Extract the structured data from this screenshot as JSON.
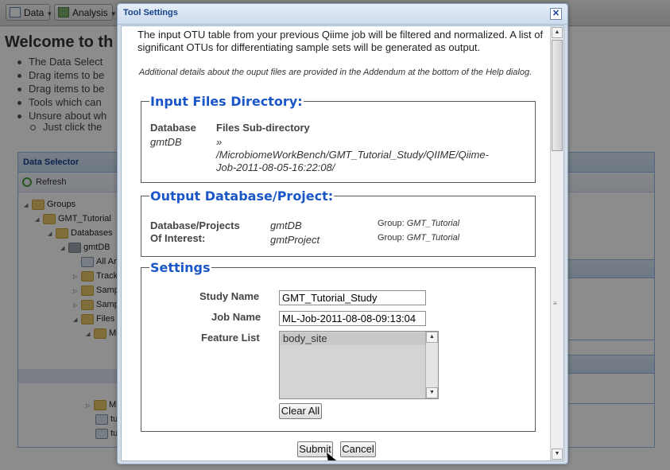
{
  "toolbar": {
    "data_label": "Data",
    "analysis_label": "Analysis"
  },
  "welcome": {
    "title": "Welcome to th",
    "bullets": [
      "The Data Select",
      "Drag items to be",
      "Drag items to be",
      "Tools which can",
      "Unsure about wh"
    ],
    "sub_bullet": "Just click the"
  },
  "data_selector": {
    "title": "Data Selector",
    "refresh_label": "Refresh",
    "tree": [
      {
        "label": "Groups"
      },
      {
        "label": "GMT_Tutorial"
      },
      {
        "label": "Databases"
      },
      {
        "label": "gmtDB"
      },
      {
        "label": "All An"
      },
      {
        "label": "Track"
      },
      {
        "label": "Samp"
      },
      {
        "label": "Samp"
      },
      {
        "label": "Files"
      },
      {
        "label": "Mi"
      },
      {
        "label": "Mi"
      },
      {
        "label": "tu"
      },
      {
        "label": "tu"
      }
    ]
  },
  "dialog": {
    "title": "Tool Settings",
    "close_icon": "close-icon",
    "intro": "The input OTU table from your previous Qiime job will be filtered and normalized. A list of significant OTUs for differentiating sample sets will be generated as output.",
    "note": "Additional details about the ouput files are provided in the Addendum at the bottom of the Help dialog.",
    "input_files": {
      "legend": "Input Files Directory:",
      "col_database": "Database",
      "col_subdir": "Files Sub-directory",
      "database_value": "gmtDB",
      "subdir_arrow": "»",
      "subdir_line1": "/MicrobiomeWorkBench/GMT_Tutorial_Study/QIIME/Qiime-",
      "subdir_line2": "Job-2011-08-05-16:22:08/"
    },
    "output": {
      "legend": "Output Database/Project:",
      "label_line1": "Database/Projects",
      "label_line2": "Of Interest:",
      "db_value": "gmtDB",
      "project_value": "gmtProject",
      "group_prefix": "Group:",
      "group_db": "GMT_Tutorial",
      "group_project": "GMT_Tutorial"
    },
    "settings": {
      "legend": "Settings",
      "study_name_label": "Study Name",
      "study_name_value": "GMT_Tutorial_Study",
      "job_name_label": "Job Name",
      "job_name_value": "ML-Job-2011-08-08-09:13:04",
      "feature_list_label": "Feature List",
      "feature_options": [
        "body_site"
      ],
      "clear_all_label": "Clear All"
    },
    "submit_label": "Submit",
    "cancel_label": "Cancel"
  }
}
